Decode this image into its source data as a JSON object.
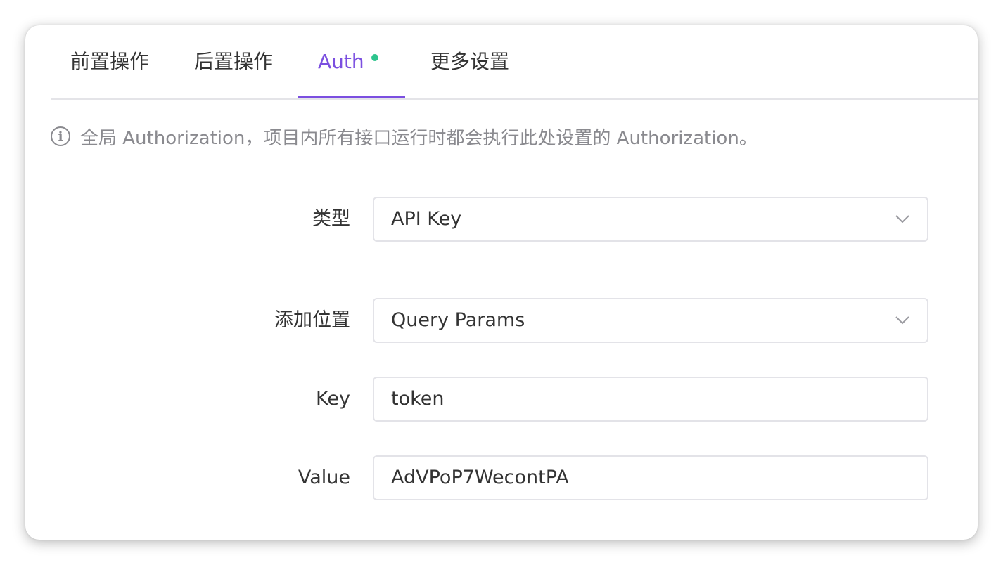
{
  "tabs": [
    {
      "label": "前置操作",
      "active": false
    },
    {
      "label": "后置操作",
      "active": false
    },
    {
      "label": "Auth",
      "active": true
    },
    {
      "label": "更多设置",
      "active": false
    }
  ],
  "colors": {
    "accent": "#7b4fe0",
    "status_dot": "#2dc48d",
    "muted_text": "#8a8a8f"
  },
  "notice": {
    "icon": "info-icon",
    "text": "全局 Authorization，项目内所有接口运行时都会执行此处设置的 Authorization。"
  },
  "form": {
    "type": {
      "label": "类型",
      "value": "API Key"
    },
    "location": {
      "label": "添加位置",
      "value": "Query Params"
    },
    "key": {
      "label": "Key",
      "value": "token"
    },
    "value": {
      "label": "Value",
      "value": "AdVPoP7WecontPA"
    }
  }
}
